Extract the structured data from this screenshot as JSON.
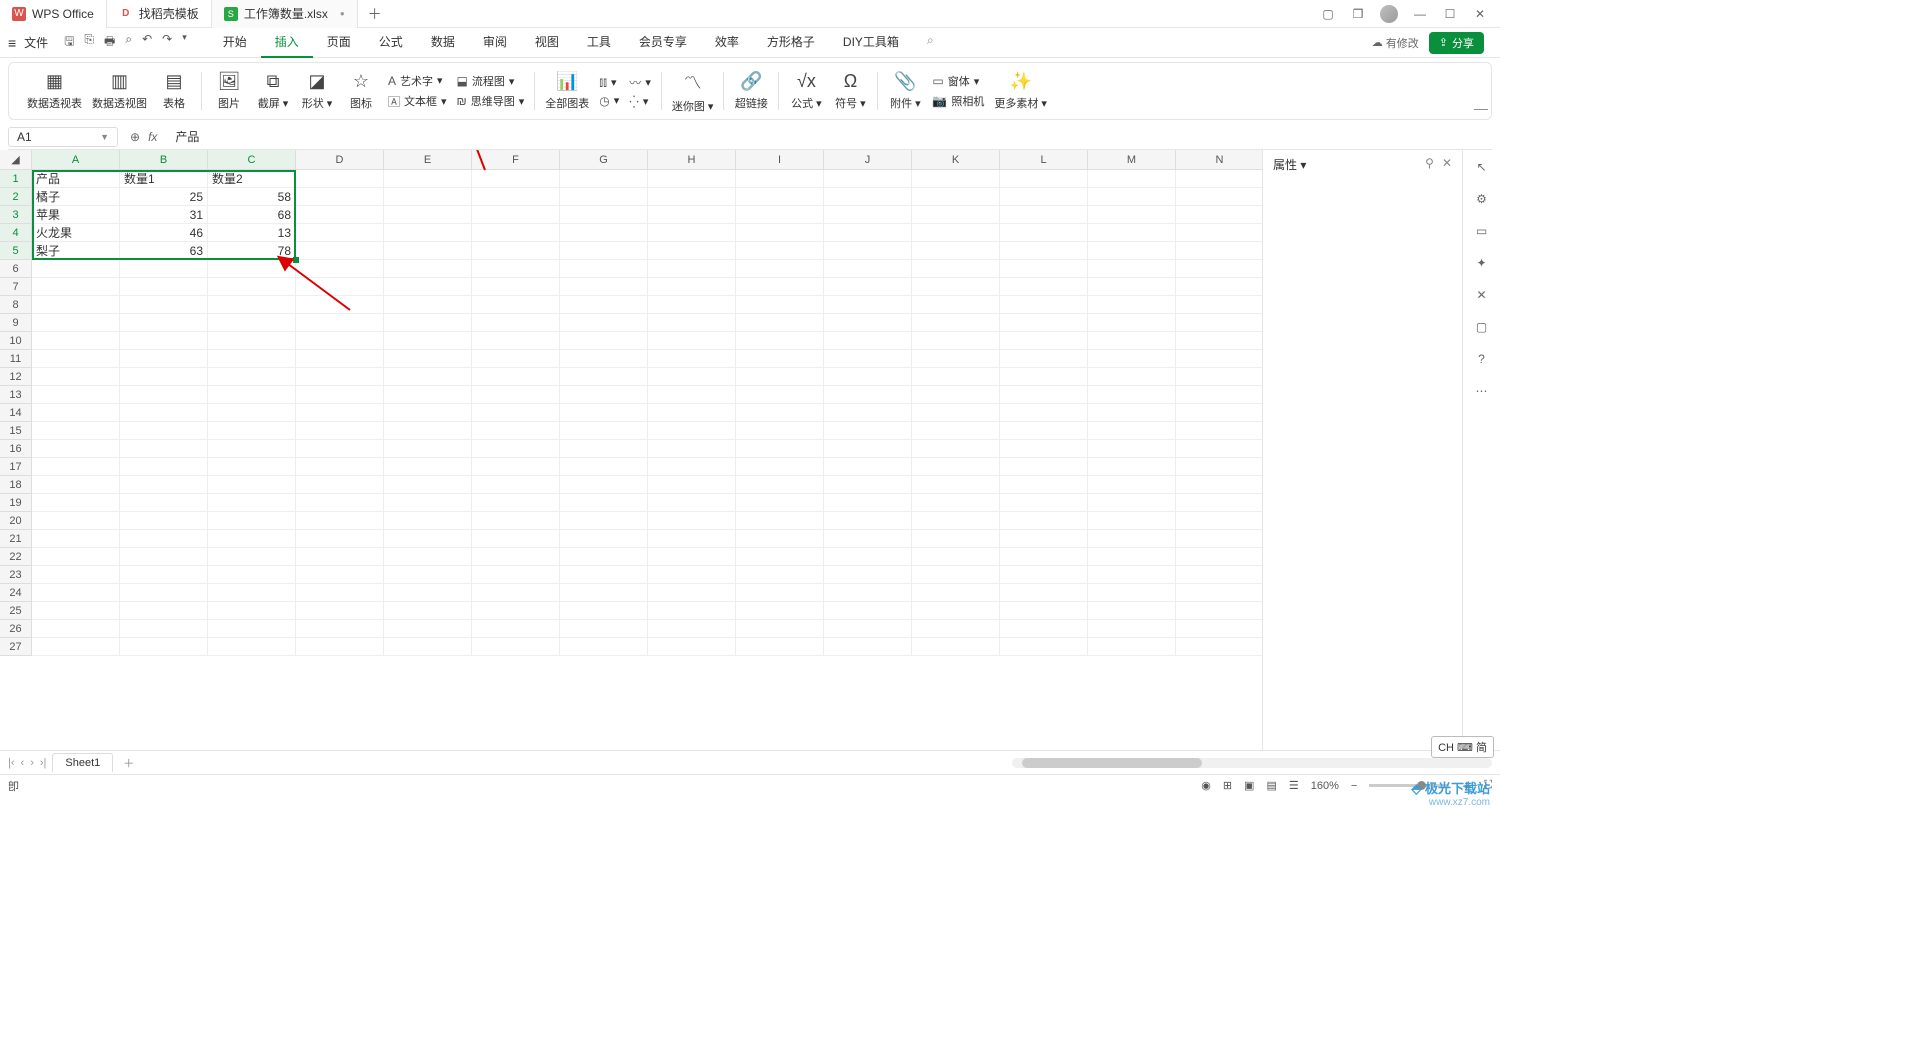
{
  "titlebar": {
    "app_tab": "WPS Office",
    "template_tab": "找稻壳模板",
    "file_tab": "工作簿数量.xlsx",
    "unsaved_dot": "●"
  },
  "menubar": {
    "file": "文件",
    "tabs": [
      "开始",
      "插入",
      "页面",
      "公式",
      "数据",
      "审阅",
      "视图",
      "工具",
      "会员专享",
      "效率",
      "方形格子",
      "DIY工具箱"
    ],
    "active_index": 1,
    "pending": "有修改",
    "share": "分享"
  },
  "ribbon": {
    "pivot_table": "数据透视表",
    "pivot_chart": "数据透视图",
    "table": "表格",
    "picture": "图片",
    "screenshot": "截屏",
    "shape": "形状",
    "icon": "图标",
    "wordart": "艺术字",
    "textbox": "文本框",
    "flowchart": "流程图",
    "mindmap": "思维导图",
    "all_charts": "全部图表",
    "sparkline": "迷你图",
    "hyperlink": "超链接",
    "formula": "公式",
    "symbol": "符号",
    "attachment": "附件",
    "form": "窗体",
    "camera": "照相机",
    "more": "更多素材"
  },
  "formula_bar": {
    "cell_ref": "A1",
    "content": "产品"
  },
  "columns": [
    "A",
    "B",
    "C",
    "D",
    "E",
    "F",
    "G",
    "H",
    "I",
    "J",
    "K",
    "L",
    "M",
    "N"
  ],
  "row_count": 27,
  "chart_data": {
    "type": "table",
    "headers": [
      "产品",
      "数量1",
      "数量2"
    ],
    "rows": [
      [
        "橘子",
        25,
        58
      ],
      [
        "苹果",
        31,
        68
      ],
      [
        "火龙果",
        46,
        13
      ],
      [
        "梨子",
        63,
        78
      ]
    ]
  },
  "selection": {
    "ref": "A1:C5"
  },
  "right_panel": {
    "title": "属性"
  },
  "sheet_tabs": {
    "active": "Sheet1"
  },
  "statusbar": {
    "mode": "卽",
    "zoom": "160%",
    "ime": "CH ⌨ 简"
  },
  "watermark": {
    "name": "极光下载站",
    "url": "www.xz7.com"
  }
}
